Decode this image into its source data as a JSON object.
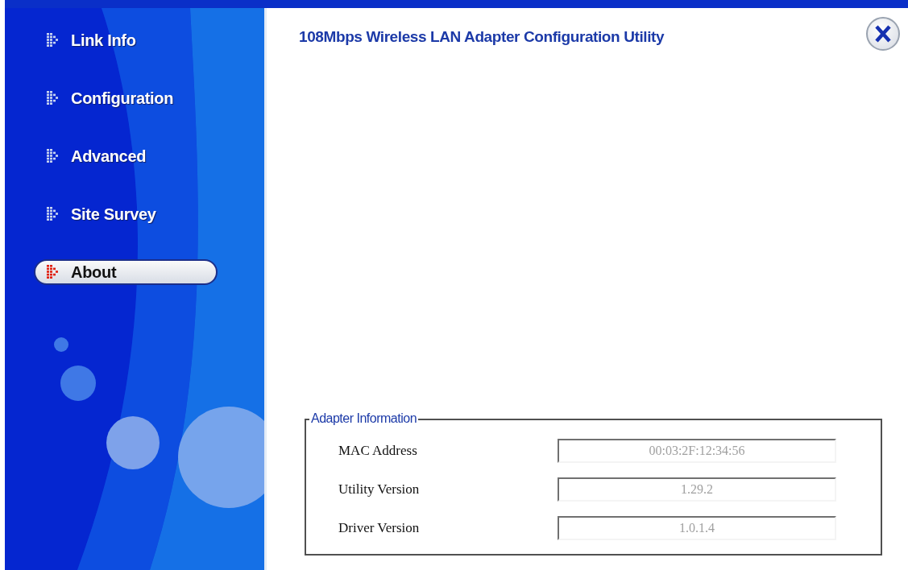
{
  "sidebar": {
    "items": [
      {
        "label": "Link Info",
        "selected": false
      },
      {
        "label": "Configuration",
        "selected": false
      },
      {
        "label": "Advanced",
        "selected": false
      },
      {
        "label": "Site Survey",
        "selected": false
      },
      {
        "label": "About",
        "selected": true
      }
    ]
  },
  "header": {
    "title": "108Mbps Wireless LAN Adapter Configuration Utility"
  },
  "adapter_information": {
    "title": "Adapter Information",
    "fields": [
      {
        "label": "MAC Address",
        "value": "00:03:2F:12:34:56"
      },
      {
        "label": "Utility Version",
        "value": "1.29.2"
      },
      {
        "label": "Driver Version",
        "value": "1.0.1.4"
      }
    ]
  }
}
